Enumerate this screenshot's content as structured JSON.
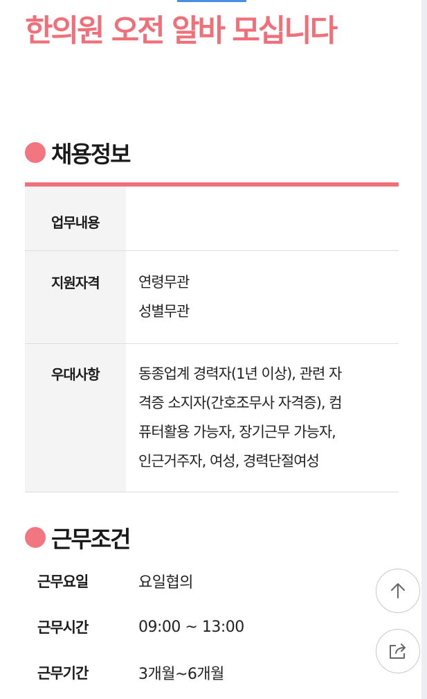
{
  "title": "한의원 오전 알바 모십니다",
  "recruit": {
    "heading": "채용정보",
    "rows": [
      {
        "label": "업무내용",
        "lines": []
      },
      {
        "label": "지원자격",
        "lines": [
          "연령무관",
          "성별무관"
        ]
      },
      {
        "label": "우대사항",
        "lines": [
          "동종업계 경력자(1년 이상), 관련 자",
          "격증 소지자(간호조무사 자격증), 컴",
          "퓨터활용 가능자, 장기근무 가능자,",
          "인근거주자, 여성, 경력단절여성"
        ]
      }
    ]
  },
  "conditions": {
    "heading": "근무조건",
    "items": [
      {
        "label": "근무요일",
        "value": "요일협의"
      },
      {
        "label": "근무시간",
        "value": "09:00 ~ 13:00"
      },
      {
        "label": "근무기간",
        "value": "3개월~6개월"
      }
    ]
  },
  "floating": {
    "top_icon": "arrow-up-icon",
    "share_icon": "share-icon"
  },
  "colors": {
    "accent": "#f0707a",
    "dot": "#f27680"
  }
}
